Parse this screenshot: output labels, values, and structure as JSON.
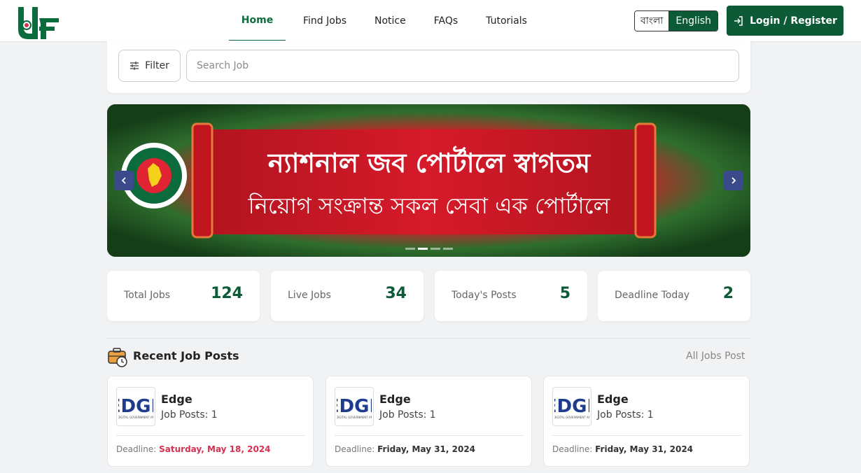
{
  "header": {
    "logo_icon": "site-logo",
    "nav": [
      {
        "label": "Home",
        "active": true
      },
      {
        "label": "Find Jobs"
      },
      {
        "label": "Notice"
      },
      {
        "label": "FAQs"
      },
      {
        "label": "Tutorials"
      }
    ],
    "lang_bn": "বাংলা",
    "lang_en": "English",
    "login_label": "Login / Register",
    "login_icon": "login-icon"
  },
  "search": {
    "filter_label": "Filter",
    "filter_icon": "sliders-icon",
    "placeholder": "Search Job"
  },
  "banner": {
    "line1": "ন্যাশনাল জব পোর্টালে স্বাগতম",
    "line2": "নিয়োগ সংক্রান্ত সকল সেবা এক পোর্টালে",
    "slide_count": 4,
    "active_slide": 2
  },
  "stats": [
    {
      "label": "Total Jobs",
      "value": "124"
    },
    {
      "label": "Live Jobs",
      "value": "34"
    },
    {
      "label": "Today's Posts",
      "value": "5"
    },
    {
      "label": "Deadline Today",
      "value": "2"
    }
  ],
  "recent": {
    "title": "Recent Job Posts",
    "all_link": "All Jobs Post",
    "icon": "briefcase-clock-icon",
    "jobs": [
      {
        "company": "Edge",
        "posts": "Job Posts: 1",
        "deadline_label": "Deadline:",
        "deadline": "Saturday, May 18, 2024",
        "urgent": true
      },
      {
        "company": "Edge",
        "posts": "Job Posts: 1",
        "deadline_label": "Deadline:",
        "deadline": "Friday, May 31, 2024",
        "urgent": false
      },
      {
        "company": "Edge",
        "posts": "Job Posts: 1",
        "deadline_label": "Deadline:",
        "deadline": "Friday, May 31, 2024",
        "urgent": false
      }
    ]
  },
  "colors": {
    "brand": "#0c5a36",
    "urgent": "#d63050",
    "accent_nav": "#3a4a8a"
  }
}
